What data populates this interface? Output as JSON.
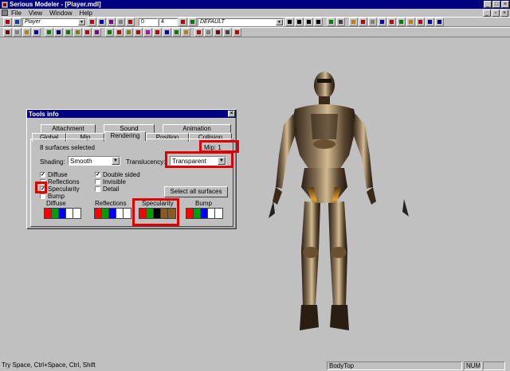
{
  "window": {
    "title": "Serious Modeler - [Player.mdl]"
  },
  "menu": {
    "items": [
      "File",
      "View",
      "Window",
      "Help"
    ]
  },
  "toolbar": {
    "model_combo": "Player",
    "frame_a": "0",
    "frame_b": "4",
    "skin_combo": "DEFAULT"
  },
  "tools_info": {
    "title": "Tools info",
    "tabs_row1": [
      "Attachment",
      "Sound",
      "Animation"
    ],
    "tabs_row2": [
      "Global",
      "Mip",
      "Rendering",
      "Position",
      "Collision"
    ],
    "active_tab": "Rendering",
    "surfaces_selected": "8 surfaces selected",
    "mip_label": "Mip: 1",
    "shading_label": "Shading:",
    "shading_value": "Smooth",
    "translucency_label": "Translucency:",
    "translucency_value": "Transparent",
    "checkboxes_left": [
      {
        "label": "Diffuse",
        "checked": true
      },
      {
        "label": "Reflections",
        "checked": false
      },
      {
        "label": "Specularity",
        "checked": true
      },
      {
        "label": "Bump",
        "checked": false
      }
    ],
    "checkboxes_right": [
      {
        "label": "Double sided",
        "checked": true
      },
      {
        "label": "Invisible",
        "checked": false
      },
      {
        "label": "Detail",
        "checked": false
      }
    ],
    "select_all_button": "Select all surfaces",
    "swatch_groups": [
      {
        "label": "Diffuse",
        "colors": [
          "#ff0000",
          "#00a000",
          "#0000ff",
          "#ffffff",
          "#ffffff"
        ]
      },
      {
        "label": "Reflections",
        "colors": [
          "#ff0000",
          "#00a000",
          "#0000ff",
          "#ffffff",
          "#ffffff"
        ]
      },
      {
        "label": "Specularity",
        "colors": [
          "#ff0000",
          "#00a000",
          "#000000",
          "#8b5a1e",
          "#8b5a1e"
        ]
      },
      {
        "label": "Bump",
        "colors": [
          "#ff0000",
          "#00a000",
          "#0000ff",
          "#ffffff",
          "#ffffff"
        ]
      }
    ]
  },
  "status": {
    "hint": "Try Space, Ctrl+Space, Ctrl, Shift",
    "surface": "BodyTop",
    "num": "NUM"
  },
  "colors": {
    "highlight": "#e00000",
    "titlebar": "#000080",
    "workspace": "#c0c0c0"
  }
}
